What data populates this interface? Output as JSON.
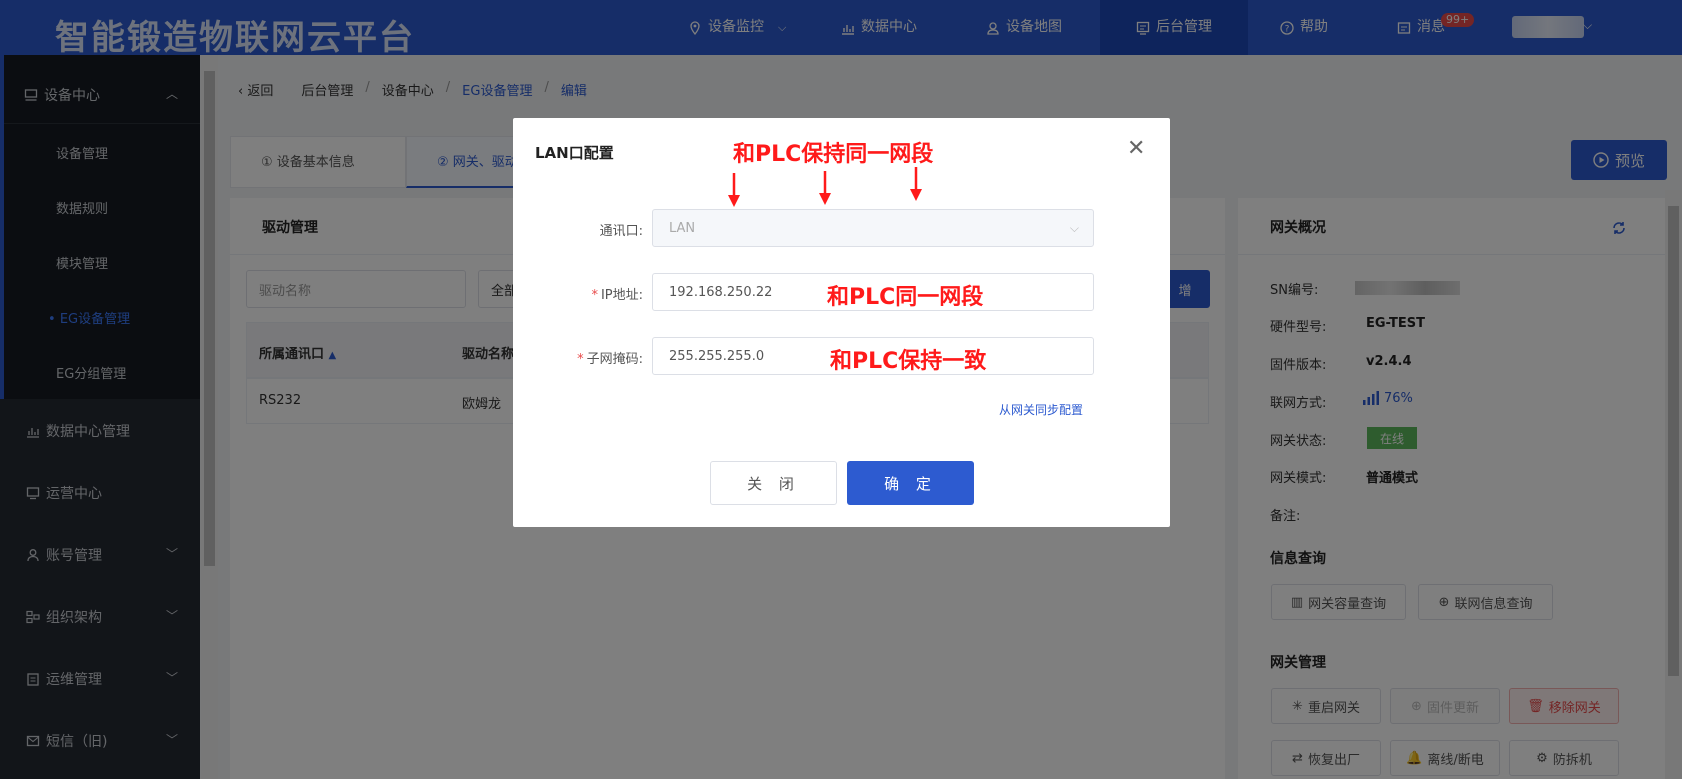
{
  "header": {
    "brand": "智能锻造物联网云平台",
    "nav": [
      "设备监控",
      "数据中心",
      "设备地图",
      "后台管理",
      "帮助",
      "消息"
    ],
    "badge": "99+"
  },
  "sidebar": {
    "group": "设备中心",
    "subitems": [
      "设备管理",
      "数据规则",
      "模块管理",
      "EG设备管理",
      "EG分组管理"
    ],
    "items": [
      "数据中心管理",
      "运营中心",
      "账号管理",
      "组织架构",
      "运维管理",
      "短信（旧)"
    ]
  },
  "breadcrumb": {
    "back": "返回",
    "items": [
      "后台管理",
      "设备中心",
      "EG设备管理",
      "编辑"
    ]
  },
  "tabs": [
    "① 设备基本信息",
    "② 网关、驱动"
  ],
  "preview_label": "预览",
  "drive": {
    "title": "驱动管理",
    "search_placeholder": "驱动名称",
    "filter_partial": "全部",
    "add_partial": "增",
    "columns": [
      "所属通讯口",
      "驱动名称"
    ],
    "rows": [
      [
        "RS232",
        "欧姆龙"
      ]
    ]
  },
  "gateway": {
    "title": "网关概况",
    "fields": [
      {
        "label": "SN编号:",
        "value": ""
      },
      {
        "label": "硬件型号:",
        "value": "EG-TEST"
      },
      {
        "label": "固件版本:",
        "value": "v2.4.4"
      },
      {
        "label": "联网方式:",
        "value": "76%"
      },
      {
        "label": "网关状态:",
        "value": "在线"
      },
      {
        "label": "网关模式:",
        "value": "普通模式"
      },
      {
        "label": "备注:",
        "value": ""
      }
    ],
    "info_title": "信息查询",
    "info_buttons": [
      "网关容量查询",
      "联网信息查询"
    ],
    "mgmt_title": "网关管理",
    "mgmt_buttons": [
      "重启网关",
      "固件更新",
      "移除网关",
      "恢复出厂",
      "离线/断电",
      "防拆机"
    ]
  },
  "modal": {
    "title": "LAN口配置",
    "port_label": "通讯口:",
    "port_value": "LAN",
    "ip_label": "IP地址:",
    "ip_value": "192.168.250.22",
    "mask_label": "子网掩码:",
    "mask_value": "255.255.255.0",
    "sync_link": "从网关同步配置",
    "cancel": "关 闭",
    "ok": "确 定"
  },
  "annotations": {
    "top": "和PLC保持同一网段",
    "ip": "和PLC同一网段",
    "mask": "和PLC保持一致"
  },
  "colors": {
    "primary": "#2d5bd0",
    "annotation": "#ff1a1a",
    "online": "#5cb85c",
    "danger": "#e84a4a"
  }
}
